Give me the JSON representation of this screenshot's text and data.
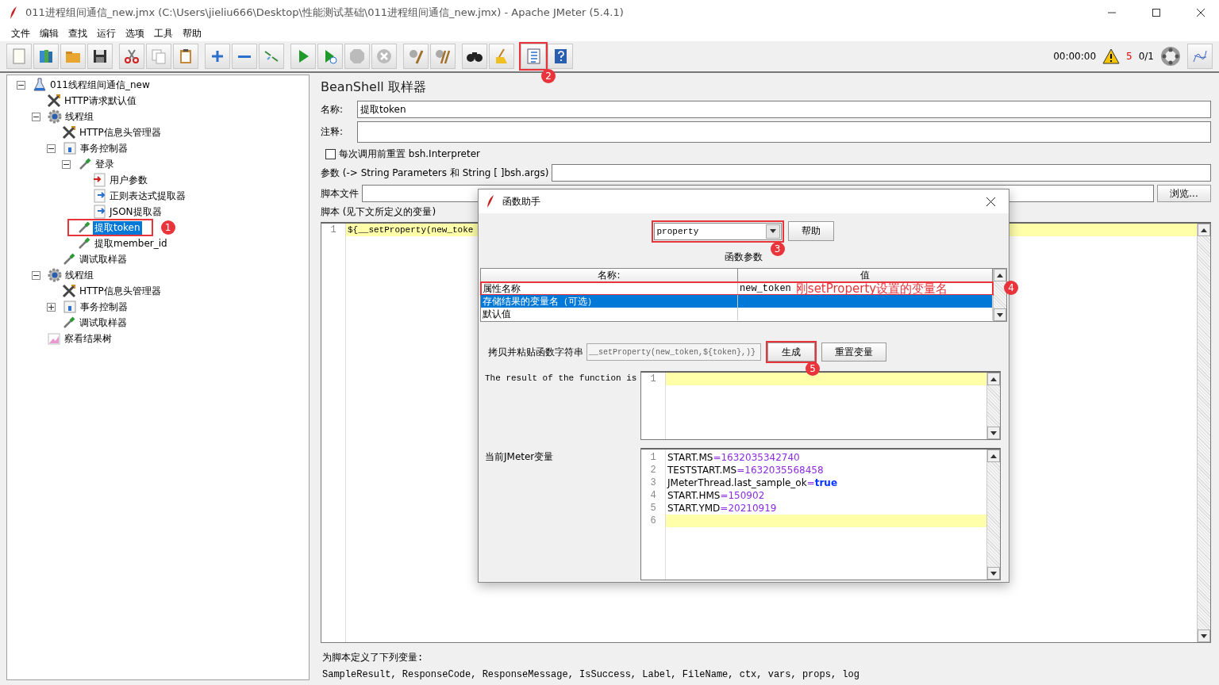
{
  "window": {
    "title": "011进程组间通信_new.jmx (C:\\Users\\jieliu666\\Desktop\\性能测试基础\\011进程组间通信_new.jmx) - Apache JMeter (5.4.1)"
  },
  "menu": [
    "文件",
    "编辑",
    "查找",
    "运行",
    "选项",
    "工具",
    "帮助"
  ],
  "toolbar": {
    "groups": [
      [
        {
          "kind": "new"
        },
        {
          "kind": "templates"
        },
        {
          "kind": "open"
        },
        {
          "kind": "save"
        }
      ],
      [
        {
          "kind": "cut"
        },
        {
          "kind": "copy"
        },
        {
          "kind": "paste"
        }
      ],
      [
        {
          "kind": "expand"
        },
        {
          "kind": "collapse"
        },
        {
          "kind": "toggle"
        }
      ],
      [
        {
          "kind": "start"
        },
        {
          "kind": "start_no_pause"
        },
        {
          "kind": "stop",
          "disabled": true
        },
        {
          "kind": "shutdown",
          "disabled": true
        }
      ],
      [
        {
          "kind": "clear"
        },
        {
          "kind": "clear_all"
        }
      ],
      [
        {
          "kind": "search"
        },
        {
          "kind": "reset_search"
        }
      ],
      [
        {
          "kind": "function_helper",
          "badge": "2"
        },
        {
          "kind": "help"
        }
      ]
    ]
  },
  "status": {
    "elapsed": "00:00:00",
    "warnings": "5",
    "threads": "0/1"
  },
  "tree": [
    {
      "label": "011线程组间通信_new",
      "kind": "plan",
      "expanded": true,
      "selected": false,
      "children": [
        {
          "label": "HTTP请求默认值",
          "kind": "config",
          "selected": false
        },
        {
          "label": "线程组",
          "kind": "threadgroup",
          "expanded": true,
          "selected": false,
          "children": [
            {
              "label": "HTTP信息头管理器",
              "kind": "config",
              "selected": false
            },
            {
              "label": "事务控制器",
              "kind": "controller",
              "expanded": true,
              "selected": false,
              "children": [
                {
                  "label": "登录",
                  "kind": "sampler",
                  "expanded": true,
                  "selected": false,
                  "children": [
                    {
                      "label": "用户参数",
                      "kind": "preprocessor",
                      "selected": false
                    },
                    {
                      "label": "正则表达式提取器",
                      "kind": "postprocessor",
                      "selected": false
                    },
                    {
                      "label": "JSON提取器",
                      "kind": "postprocessor",
                      "selected": false
                    }
                  ]
                },
                {
                  "label": "提取token",
                  "kind": "sampler",
                  "selected": true,
                  "badge": "1"
                },
                {
                  "label": "提取member_id",
                  "kind": "sampler",
                  "selected": false
                }
              ]
            },
            {
              "label": "调试取样器",
              "kind": "sampler",
              "selected": false
            }
          ]
        },
        {
          "label": "线程组",
          "kind": "threadgroup",
          "expanded": true,
          "selected": false,
          "children": [
            {
              "label": "HTTP信息头管理器",
              "kind": "config",
              "selected": false
            },
            {
              "label": "事务控制器",
              "kind": "controller",
              "expanded": false,
              "selected": false
            },
            {
              "label": "调试取样器",
              "kind": "sampler",
              "selected": false
            }
          ]
        },
        {
          "label": "察看结果树",
          "kind": "listener",
          "selected": false
        }
      ]
    }
  ],
  "editor": {
    "title": "BeanShell 取样器",
    "name_label": "名称:",
    "name_value": "提取token",
    "comment_label": "注释:",
    "reset_option": {
      "label": "每次调用前重置 bsh.Interpreter",
      "checked": false
    },
    "params_label": "参数 (-> String Parameters 和 String [ ]bsh.args)",
    "script_file_label": "脚本文件",
    "browse_button": "浏览...",
    "script_label": "脚本 (见下文所定义的变量)",
    "script_lines": [
      {
        "number": "1",
        "text": "${__setProperty(new_toke",
        "current": true
      }
    ],
    "defined_vars_label": "为脚本定义了下列变量:",
    "defined_vars": "SampleResult, ResponseCode, ResponseMessage, IsSuccess, Label, FileName, ctx, vars, props, log"
  },
  "dialog": {
    "title": "函数助手",
    "function": {
      "value": "property",
      "badge": "3"
    },
    "help_button": "帮助",
    "params_title": "函数参数",
    "columns": [
      "名称:",
      "值"
    ],
    "rows": [
      {
        "name": "属性名称",
        "value": "new_token",
        "selected": false,
        "note": "刚setProperty设置的变量名",
        "badge": "4"
      },
      {
        "name": "存储结果的变量名（可选）",
        "selected": true
      },
      {
        "name": "默认值",
        "selected": false
      }
    ],
    "copy_label": "拷贝并粘贴函数字符串",
    "function_string": "__setProperty(new_token,${token},)}",
    "generate_button": {
      "label": "生成",
      "badge": "5"
    },
    "reset_button": "重置变量",
    "result_label": "The result of the function is",
    "result_lines": [
      {
        "number": "1",
        "current": true
      }
    ],
    "vars_label": "当前JMeter变量",
    "vars_lines": [
      {
        "number": "1",
        "text": "START.MS=1632035342740",
        "kind": "number"
      },
      {
        "number": "2",
        "text": "TESTSTART.MS=1632035568458",
        "kind": "number"
      },
      {
        "number": "3",
        "text": "JMeterThread.last_sample_ok=true",
        "kind": "boolean"
      },
      {
        "number": "4",
        "text": "START.HMS=150902",
        "kind": "number"
      },
      {
        "number": "5",
        "text": "START.YMD=20210919",
        "kind": "number"
      },
      {
        "number": "6",
        "current": true
      }
    ]
  }
}
